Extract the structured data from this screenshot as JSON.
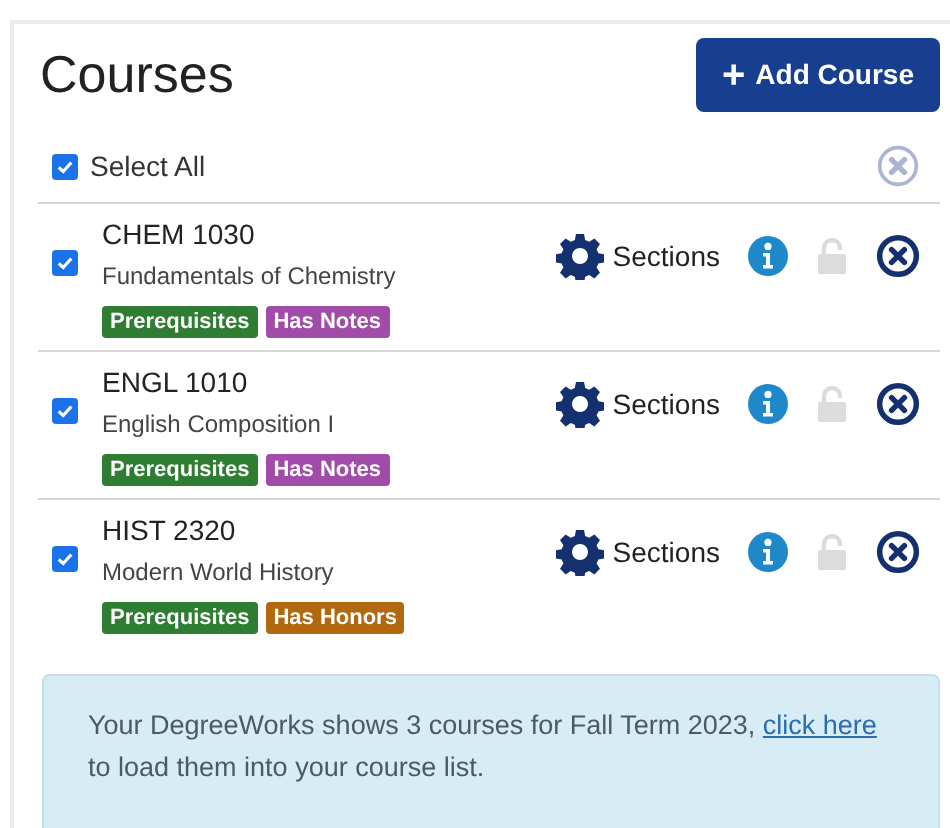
{
  "title": "Courses",
  "add_button": {
    "icon": "+",
    "label": "Add Course"
  },
  "select_all": {
    "label": "Select All",
    "checked": true
  },
  "courses": [
    {
      "code": "CHEM 1030",
      "name": "Fundamentals of Chemistry",
      "checked": true,
      "locked": false,
      "sections_label": "Sections",
      "tags": [
        {
          "label": "Prerequisites",
          "color": "#2e7d32"
        },
        {
          "label": "Has Notes",
          "color": "#a04ca8"
        }
      ]
    },
    {
      "code": "ENGL 1010",
      "name": "English Composition I",
      "checked": true,
      "locked": false,
      "sections_label": "Sections",
      "tags": [
        {
          "label": "Prerequisites",
          "color": "#2e7d32"
        },
        {
          "label": "Has Notes",
          "color": "#a04ca8"
        }
      ]
    },
    {
      "code": "HIST 2320",
      "name": "Modern World History",
      "checked": true,
      "locked": false,
      "sections_label": "Sections",
      "tags": [
        {
          "label": "Prerequisites",
          "color": "#2e7d32"
        },
        {
          "label": "Has Honors",
          "color": "#b2680f"
        }
      ]
    }
  ],
  "notice": {
    "text_before": "Your DegreeWorks shows 3 courses for Fall Term 2023, ",
    "link": "click here",
    "text_after": " to load them into your course list."
  }
}
